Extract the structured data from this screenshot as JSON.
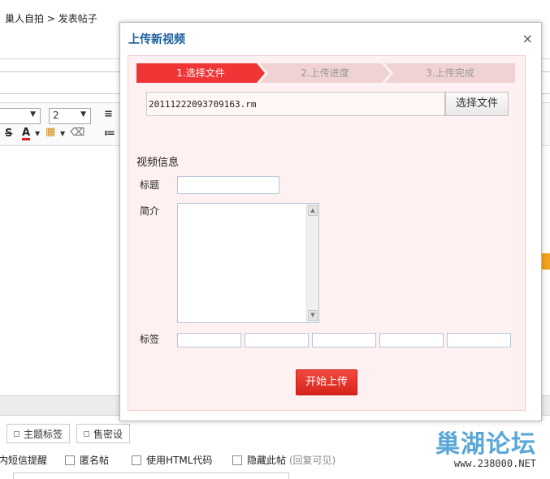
{
  "breadcrumb": {
    "section": "巢人自拍",
    "separator": ">",
    "page": "发表帖子"
  },
  "editor": {
    "font_select": "",
    "size_select": "2",
    "tools": [
      "S",
      "A",
      "▦",
      "⌫",
      "≡",
      "≔"
    ]
  },
  "tabs": [
    {
      "label": "主题标签"
    },
    {
      "label": "售密设"
    }
  ],
  "options": [
    {
      "label": "内短信提醒",
      "checkbox": false
    },
    {
      "label": "匿名帖",
      "checkbox": true
    },
    {
      "label": "使用HTML代码",
      "checkbox": true
    },
    {
      "label": "隐藏此帖",
      "checkbox": true,
      "note": "(回复可见)"
    }
  ],
  "watermark": {
    "main": "巢湖论坛",
    "url": "www.238000.NET"
  },
  "dialog": {
    "title": "上传新视频",
    "close_label": "×",
    "steps": [
      "1.选择文件",
      "2.上传进度",
      "3.上传完成"
    ],
    "file_value": "20111222093709163.rm",
    "choose_file_label": "选择文件",
    "section_title": "视频信息",
    "title_label": "标题",
    "intro_label": "简介",
    "tags_label": "标签",
    "submit_label": "开始上传"
  }
}
